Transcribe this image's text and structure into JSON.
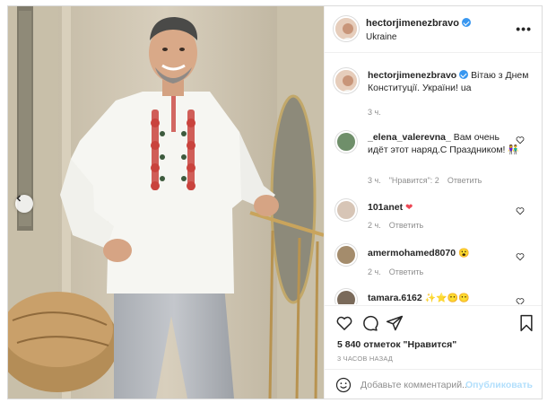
{
  "post": {
    "username": "hectorjimenezbravo",
    "location": "Ukraine",
    "more_label": "•••"
  },
  "caption": {
    "username": "hectorjimenezbravo",
    "text": "Вітаю з Днем Конституції. України! ua",
    "time": "3 ч."
  },
  "comments": [
    {
      "username": "_elena_valerevna_",
      "text": "Вам очень идёт этот наряд.С Праздником!",
      "emoji": "👫",
      "time": "3 ч.",
      "likes": "\"Нравится\": 2",
      "reply": "Ответить"
    },
    {
      "username": "101anet",
      "text": "",
      "emoji": "❤",
      "time": "2 ч.",
      "reply": "Ответить"
    },
    {
      "username": "amermohamed8070",
      "text": "",
      "emoji": "😮",
      "time": "2 ч.",
      "reply": "Ответить"
    },
    {
      "username": "tamara.6162",
      "text": "",
      "emoji": "✨⭐😶😶",
      "time": "",
      "reply": ""
    }
  ],
  "footer": {
    "likes": "5 840 отметок \"Нравится\"",
    "time_ago": "3 ЧАСОВ НАЗАД",
    "comment_placeholder": "Добавьте комментарий...",
    "publish_label": "Опубликовать"
  },
  "icons": {
    "like": "heart-icon",
    "comment": "comment-icon",
    "share": "share-icon",
    "save": "bookmark-icon",
    "emoji": "smiley-icon",
    "prev": "chevron-left-icon",
    "options": "more-options-icon"
  },
  "colors": {
    "verified": "#3897f0",
    "publish_disabled": "#b2dffc",
    "muted": "#8e8e8e",
    "heart_red": "#ed4956"
  }
}
